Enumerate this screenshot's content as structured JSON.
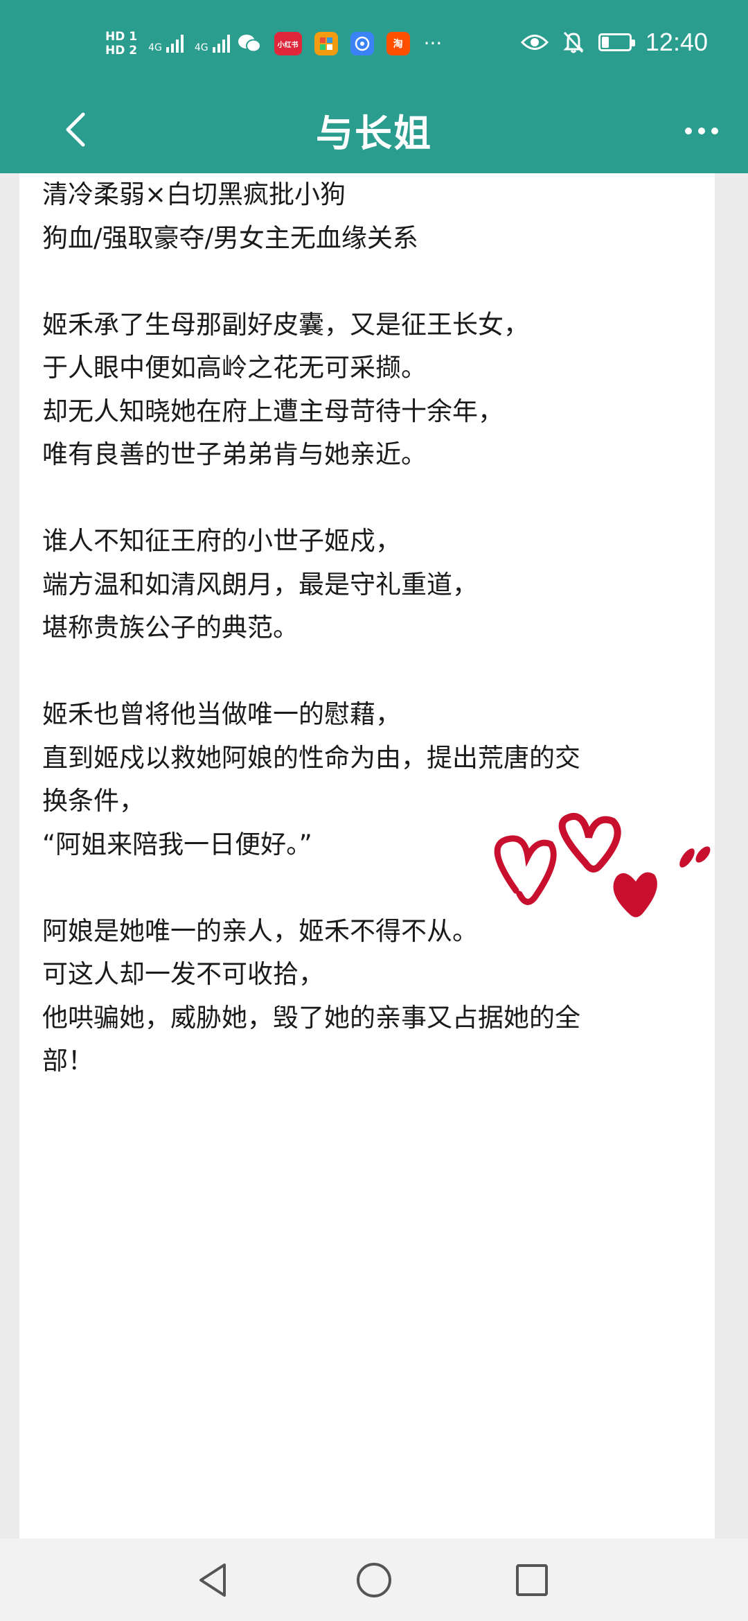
{
  "status_bar": {
    "sim1": "HD 1",
    "sim2": "HD 2",
    "network1": "4G",
    "network2": "4G",
    "app_icon_1": "小红书",
    "app_icon_2": "淘",
    "more": "···",
    "time": "12:40",
    "battery_level": 0.25,
    "icons": [
      "eye-icon",
      "mute-bell-icon",
      "battery-icon",
      "wechat-icon"
    ]
  },
  "header": {
    "title": "与长姐",
    "back_icon": "chevron-left-icon",
    "more_icon": "more-dots-icon"
  },
  "colors": {
    "accent": "#2a9d8f",
    "heart": "#c8102e"
  },
  "content": {
    "lines": [
      "清冷柔弱×白切黑疯批小狗",
      "狗血/强取豪夺/男女主无血缘关系",
      "",
      "姬禾承了生母那副好皮囊，又是征王长女，",
      "于人眼中便如高岭之花无可采撷。",
      "却无人知晓她在府上遭主母苛待十余年，",
      "唯有良善的世子弟弟肯与她亲近。",
      "",
      "谁人不知征王府的小世子姬戍，",
      "端方温和如清风朗月，最是守礼重道，",
      "堪称贵族公子的典范。",
      "",
      "姬禾也曾将他当做唯一的慰藉，",
      "直到姬戍以救她阿娘的性命为由，提出荒唐的交",
      "换条件，",
      "“阿姐来陪我一日便好。”",
      "",
      "阿娘是她唯一的亲人，姬禾不得不从。",
      "可这人却一发不可收拾，",
      "他哄骗她，威胁她，毁了她的亲事又占据她的全",
      "部！"
    ]
  },
  "nav_bar": {
    "icons": [
      "back-triangle-icon",
      "home-circle-icon",
      "recents-square-icon"
    ]
  }
}
